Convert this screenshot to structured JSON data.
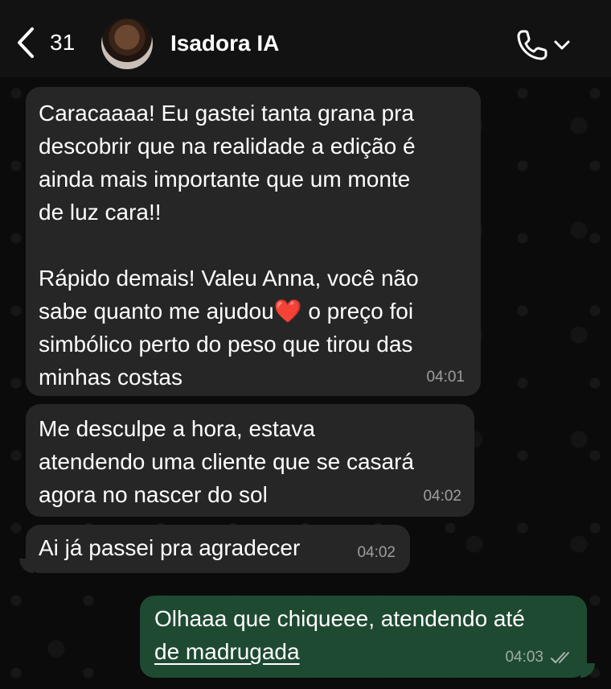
{
  "header": {
    "unread_count": "31",
    "contact_name": "Isadora IA"
  },
  "messages": [
    {
      "direction": "incoming",
      "text": "Caracaaaa! Eu gastei tanta grana pra\ndescobrir que na realidade a edição é\nainda mais importante que um monte\nde luz cara!!\n\nRápido demais! Valeu Anna, você não\nsabe quanto me ajudou❤️ o preço foi\nsimbólico perto do peso que tirou das\nminhas costas",
      "time": "04:01"
    },
    {
      "direction": "incoming",
      "text": "Me desculpe a hora, estava\natendendo uma cliente que se casará\nagora no nascer do sol",
      "time": "04:02"
    },
    {
      "direction": "incoming",
      "text": "Ai já passei pra agradecer",
      "time": "04:02"
    },
    {
      "direction": "outgoing",
      "text_line1": "Olhaaa que chiqueee, atendendo até",
      "text_line2": "de madrugada",
      "time": "04:03",
      "status": "read-checkmarks-icon"
    }
  ],
  "colors": {
    "incoming_bubble": "#262626",
    "outgoing_bubble": "#1f4a32",
    "background": "#0b0b0b"
  }
}
